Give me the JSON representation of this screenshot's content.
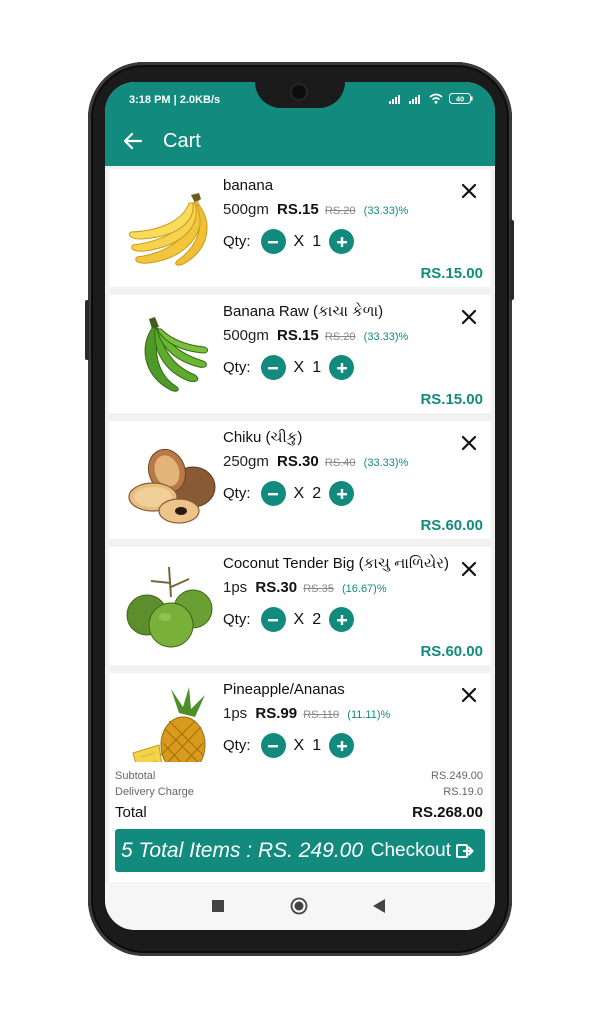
{
  "status_bar": {
    "time": "3:18 PM | 2.0KB/s",
    "battery": "40"
  },
  "app_bar": {
    "title": "Cart",
    "back_icon": "arrow-left-icon"
  },
  "cart_items": [
    {
      "name": "banana",
      "unit": "500gm",
      "price": "RS.15",
      "mrp": "RS.20",
      "discount": "(33.33)%",
      "qty_label": "Qty:",
      "times": "X",
      "qty": "1",
      "total": "RS.15.00",
      "image": "banana-image"
    },
    {
      "name": "Banana Raw (કાચા કેળા)",
      "unit": "500gm",
      "price": "RS.15",
      "mrp": "RS.20",
      "discount": "(33.33)%",
      "qty_label": "Qty:",
      "times": "X",
      "qty": "1",
      "total": "RS.15.00",
      "image": "raw-banana-image"
    },
    {
      "name": "Chiku (ચીકુ)",
      "unit": "250gm",
      "price": "RS.30",
      "mrp": "RS.40",
      "discount": "(33.33)%",
      "qty_label": "Qty:",
      "times": "X",
      "qty": "2",
      "total": "RS.60.00",
      "image": "chiku-image"
    },
    {
      "name": "Coconut Tender Big (કાચુ નાળિયેર)",
      "unit": "1ps",
      "price": "RS.30",
      "mrp": "RS.35",
      "discount": "(16.67)%",
      "qty_label": "Qty:",
      "times": "X",
      "qty": "2",
      "total": "RS.60.00",
      "image": "coconut-image"
    },
    {
      "name": "Pineapple/Ananas",
      "unit": "1ps",
      "price": "RS.99",
      "mrp": "RS.110",
      "discount": "(11.11)%",
      "qty_label": "Qty:",
      "times": "X",
      "qty": "1",
      "total": "",
      "image": "pineapple-image"
    }
  ],
  "summary": {
    "subtotal_label": "Subtotal",
    "subtotal_value": "RS.249.00",
    "delivery_label": "Delivery Charge",
    "delivery_value": "RS.19.0",
    "total_label": "Total",
    "total_value": "RS.268.00"
  },
  "checkout": {
    "count_text": "5 Total Items : RS. 249.00",
    "label": "Checkout",
    "icon": "exit-arrow-icon"
  },
  "nav": {
    "recent": "square-icon",
    "home": "circle-icon",
    "back": "triangle-back-icon"
  },
  "colors": {
    "primary": "#128b7e",
    "background": "#f1f1f1"
  }
}
